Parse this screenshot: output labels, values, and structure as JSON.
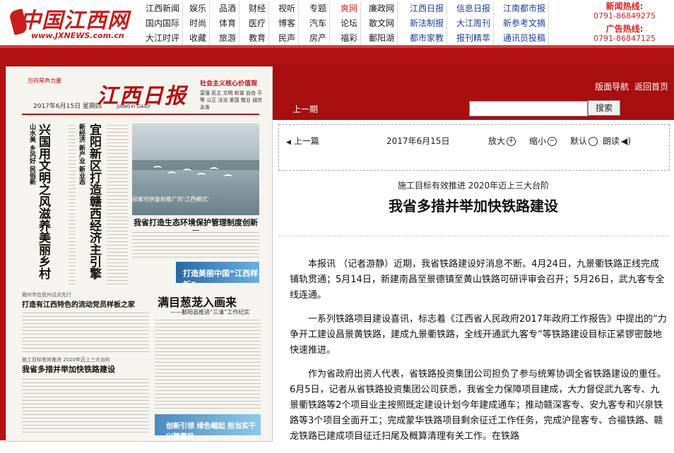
{
  "site": {
    "logo_text": "中国江西网",
    "logo_url": "www.JXNEWS.com.cn"
  },
  "nav": [
    [
      "江西新闻",
      "娱乐",
      "品酒",
      "财经",
      "视听",
      "专题",
      "爽网",
      "廉政网",
      "江西日报",
      "信息日报",
      "江南都市报"
    ],
    [
      "国内国际",
      "时尚",
      "体育",
      "医疗",
      "博客",
      "汽车",
      "论坛",
      "散文网",
      "新法制报",
      "大江周刊",
      "新参考文摘"
    ],
    [
      "大江时评",
      "收藏",
      "旅游",
      "教育",
      "民声",
      "房产",
      "福彩",
      "鄱阳湖",
      "都市家教",
      "报刊精萃",
      "通讯员投稿"
    ]
  ],
  "hotlines": {
    "news_label": "新闻热线:",
    "news_number": "0791-86849275",
    "ad_label": "广告热线:",
    "ad_number": "0791-86847125"
  },
  "header_links": {
    "layout_nav": "版面导航",
    "back_home": "返回首页",
    "prev_issue": "上一期",
    "search_button": "搜索",
    "search_value": ""
  },
  "newspaper": {
    "brand": "万向琴声力量",
    "name": "江西日报",
    "name_en": "JIANGXI DAILY",
    "date": "2017年6月15日",
    "weekday": "星期四",
    "core_values_title": "社会主义核心价值观",
    "core_values_text": "富强 民主 文明 和谐 自由 平等 公正 法治 爱国 敬业 诚信 友善",
    "headline_left": "兴国用文明之风滋养美丽乡村",
    "headline_left_sub": "山水美 乡风好 民俗新",
    "headline_mid": "宜阳新区打造赣西经济主引擎",
    "headline_mid_sub": "新经济 新产业 新业态",
    "photo_caption": "我省打造生态环境保护管理制度创新区",
    "photo_tag": "探索可供复制推广的'江西模式'",
    "blue_box": "打造美丽中国“江西样板”",
    "center_head": "满目葱茏入画来",
    "center_sub": "——鄱阳县推进“三清”工作纪实",
    "left_head": "打造有江西特色的流动党员样板之家",
    "left_head_pre": "赣州市在抚州试点先行",
    "bottom_head_pre": "施工目标有效推进 2020年迈上三大台阶",
    "bottom_head": "我省多措并举加快铁路建设",
    "green_box": "创新引领 绿色崛起 担当实干 兴赣富民"
  },
  "toolbar": {
    "prev_article": "上一篇",
    "date": "2017年6月15日",
    "zoom_in": "放大",
    "zoom_out": "缩小",
    "default": "默认",
    "read_aloud": "朗读"
  },
  "article": {
    "subtitle": "施工目标有效推进 2020年迈上三大台阶",
    "title": "我省多措并举加快铁路建设",
    "paragraphs": [
      "本报讯 （记者游静）近期，我省铁路建设好消息不断。4月24日，九景衢铁路正线完成铺轨贯通；5月14日，新建南昌至景德镇至黄山铁路可研评审会召开；5月26日，武九客专全线连通。",
      "一系列铁路项目建设喜讯，标志着《江西省人民政府2017年政府工作报告》中提出的“力争开工建设昌景黄铁路，建成九景衢铁路，全线开通武九客专”等铁路建设目标正紧锣密鼓地快速推进。",
      "作为省政府出资人代表，省铁路投资集团公司担负了参与统筹协调全省铁路建设的重任。6月5日，记者从省铁路投资集团公司获悉，我省全力保障项目建成，大力督促武九客专、九景衢铁路等2个项目业主按照既定建设计划今年建成通车；推动赣深客专、安九客专和兴泉铁路等3个项目全面开工；完成蒙华铁路项目剩余征迁工作任务，完成沪昆客专、合福铁路、赣龙铁路已建成项目征迁扫尾及概算清理有关工作。在铁路"
    ]
  },
  "colors": {
    "brand_red": "#b31212",
    "link_blue": "#1a3f99"
  }
}
